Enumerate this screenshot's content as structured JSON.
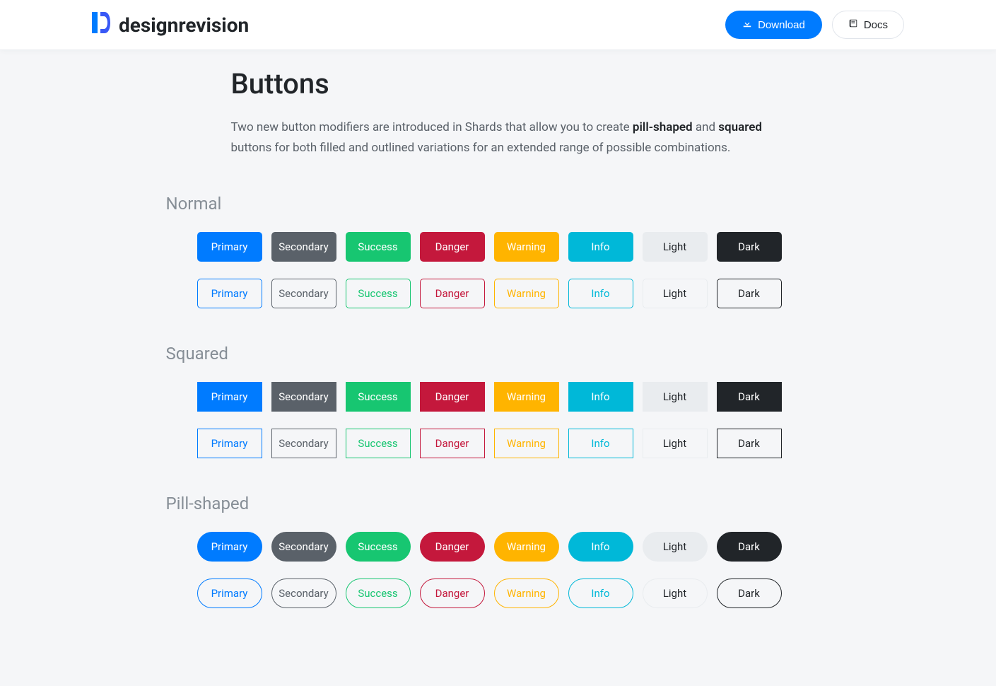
{
  "header": {
    "brand": "designrevision",
    "download_label": "Download",
    "docs_label": "Docs"
  },
  "page": {
    "title": "Buttons",
    "description_prefix": "Two new button modifiers are introduced in Shards that allow you to create ",
    "description_bold1": "pill-shaped",
    "description_mid": " and ",
    "description_bold2": "squared",
    "description_suffix": " buttons for both filled and outlined variations for an extended range of possible combinations."
  },
  "sections": {
    "normal": "Normal",
    "squared": "Squared",
    "pill": "Pill-shaped"
  },
  "buttons": {
    "primary": "Primary",
    "secondary": "Secondary",
    "success": "Success",
    "danger": "Danger",
    "warning": "Warning",
    "info": "Info",
    "light": "Light",
    "dark": "Dark"
  }
}
